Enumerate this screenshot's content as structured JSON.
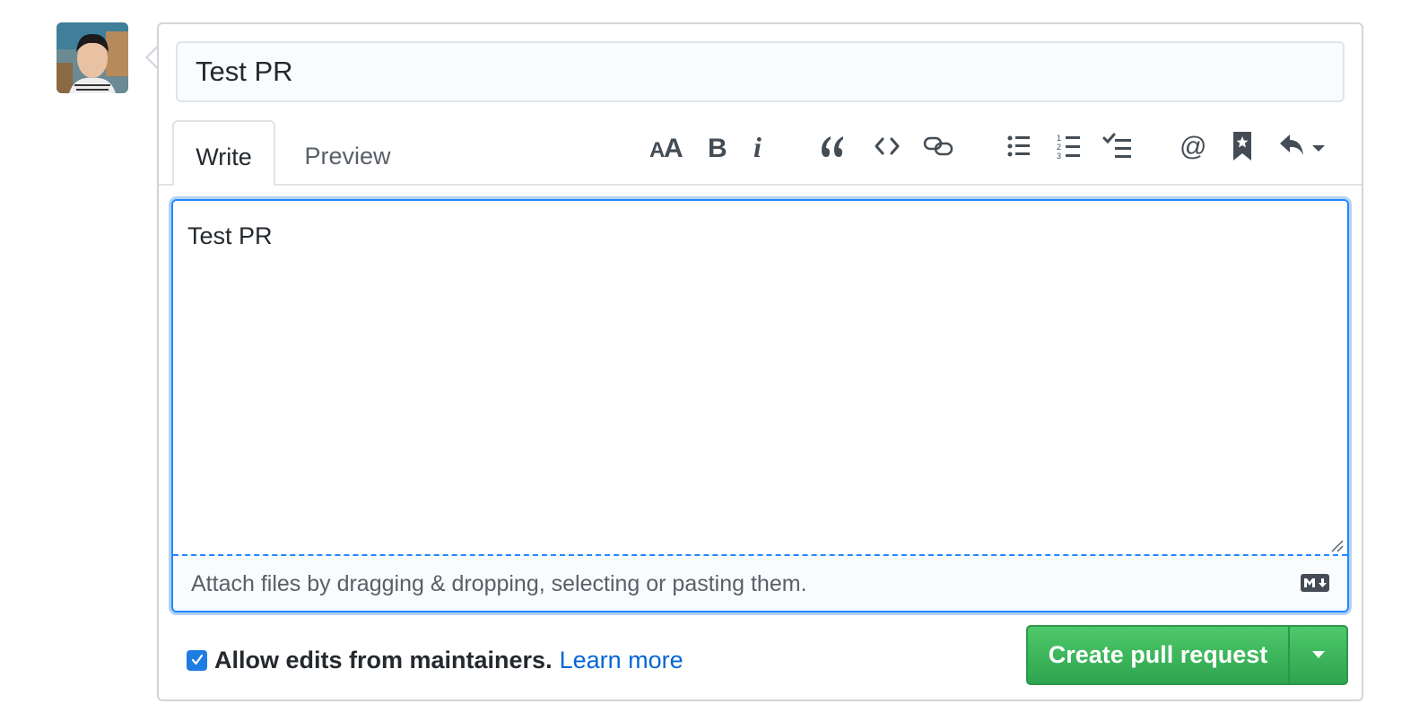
{
  "pr_form": {
    "title_value": "Test PR",
    "tabs": [
      {
        "label": "Write",
        "active": true
      },
      {
        "label": "Preview",
        "active": false
      }
    ],
    "toolbar": [
      "text-size-icon",
      "bold-icon",
      "italic-icon",
      "quote-icon",
      "code-icon",
      "link-icon",
      "unordered-list-icon",
      "ordered-list-icon",
      "task-list-icon",
      "mention-icon",
      "saved-reply-icon",
      "reply-icon"
    ],
    "body_value": "Test PR",
    "attach_text": "Attach files by dragging & dropping, selecting or pasting them.",
    "markdown_icon": "markdown-icon",
    "allow_edits": {
      "checked": true,
      "label": "Allow edits from maintainers.",
      "link": "Learn more"
    },
    "submit": {
      "label": "Create pull request",
      "caret": "chevron-down-icon"
    }
  },
  "colors": {
    "accent_blue": "#2188ff",
    "link": "#0366d6",
    "button_green": "#2ea44f",
    "border": "#d1d5da"
  }
}
